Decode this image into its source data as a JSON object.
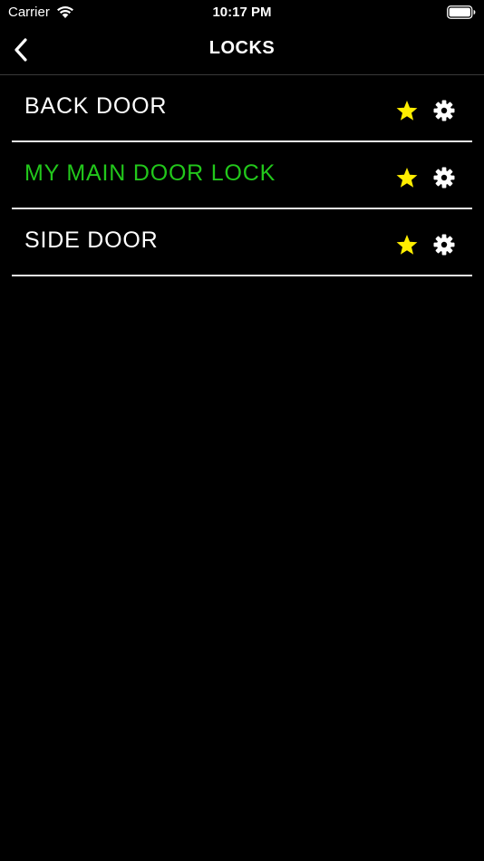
{
  "status_bar": {
    "carrier": "Carrier",
    "time": "10:17 PM",
    "wifi_icon": "wifi-icon",
    "battery_icon": "battery-icon"
  },
  "nav": {
    "title": "LOCKS",
    "back_icon": "chevron-left-icon"
  },
  "colors": {
    "background": "#000000",
    "active_text": "#22c71b",
    "star": "#ffee00",
    "divider": "#e8e8e8"
  },
  "locks": [
    {
      "name": "BACK DOOR",
      "active": false,
      "favorite_icon": "star-icon",
      "settings_icon": "gear-icon"
    },
    {
      "name": "MY MAIN DOOR LOCK",
      "active": true,
      "favorite_icon": "star-icon",
      "settings_icon": "gear-icon"
    },
    {
      "name": "SIDE DOOR",
      "active": false,
      "favorite_icon": "star-icon",
      "settings_icon": "gear-icon"
    }
  ]
}
